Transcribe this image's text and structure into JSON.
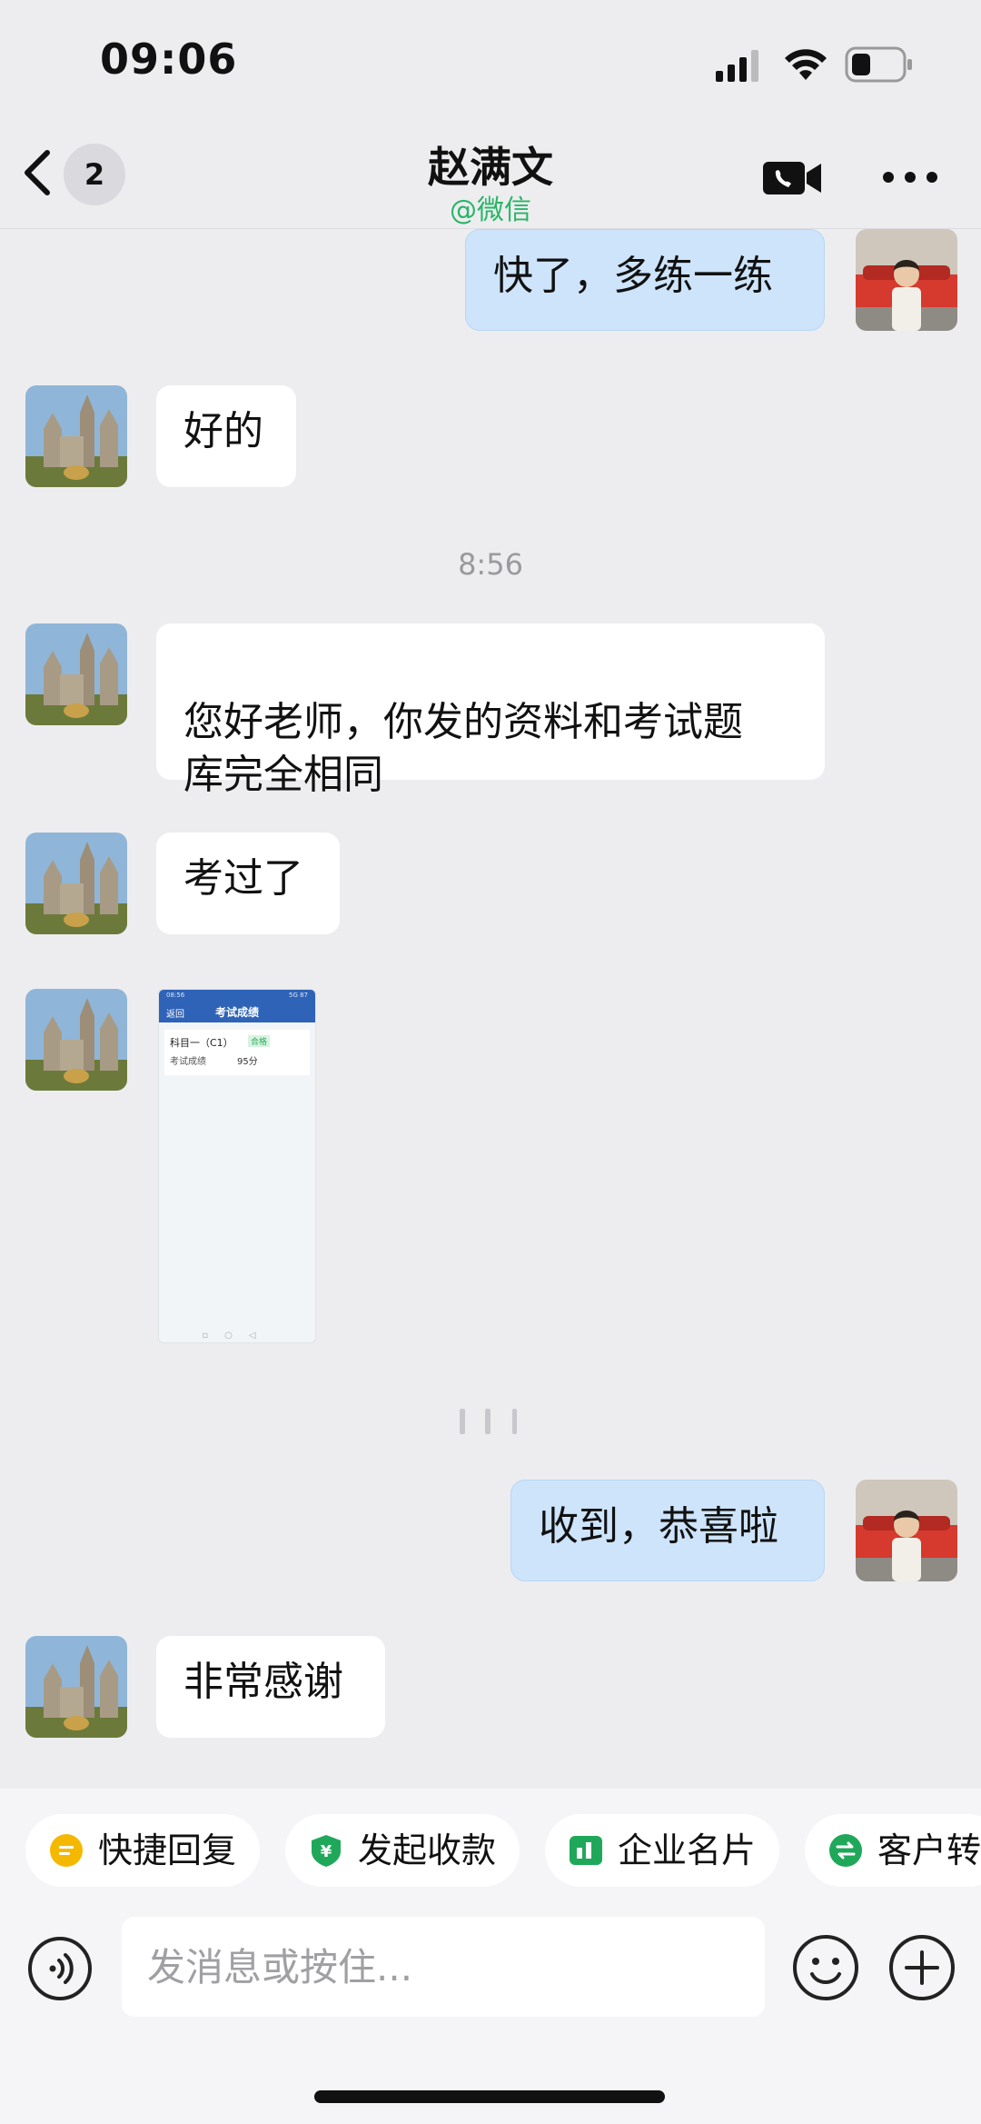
{
  "status_bar": {
    "time": "09:06"
  },
  "header": {
    "back_badge": "2",
    "title": "赵满文",
    "subtitle": "@微信"
  },
  "messages": [
    {
      "side": "out",
      "text": "快了，多练一练"
    },
    {
      "side": "in",
      "text": "好的"
    },
    {
      "type": "time",
      "text": "8:56"
    },
    {
      "side": "in",
      "text": "您好老师，你发的资料和考试题\n库完全相同"
    },
    {
      "side": "in",
      "text": "考过了"
    },
    {
      "side": "in",
      "type": "image"
    },
    {
      "side": "out",
      "text": "收到，恭喜啦"
    },
    {
      "side": "in",
      "text": "非常感谢"
    }
  ],
  "shared_image": {
    "status": "08:56",
    "status_right": "5G 87",
    "back": "返回",
    "title": "考试成绩",
    "subject": "科目一（C1）",
    "badge": "合格",
    "score_label": "考试成绩",
    "score_value": "95分"
  },
  "quick_actions": [
    {
      "label": "快捷回复",
      "icon": "quick-reply-icon",
      "color": "#F5B800"
    },
    {
      "label": "发起收款",
      "icon": "payment-icon",
      "color": "#1FA85A"
    },
    {
      "label": "企业名片",
      "icon": "business-card-icon",
      "color": "#1FA85A"
    },
    {
      "label": "客户转",
      "icon": "transfer-icon",
      "color": "#1FA85A"
    }
  ],
  "input": {
    "placeholder": "发消息或按住..."
  },
  "colors": {
    "accent_green": "#2AB567",
    "outgoing_bubble": "#CDE4FB",
    "incoming_bubble": "#FFFFFF",
    "background": "#EDEDF0"
  }
}
